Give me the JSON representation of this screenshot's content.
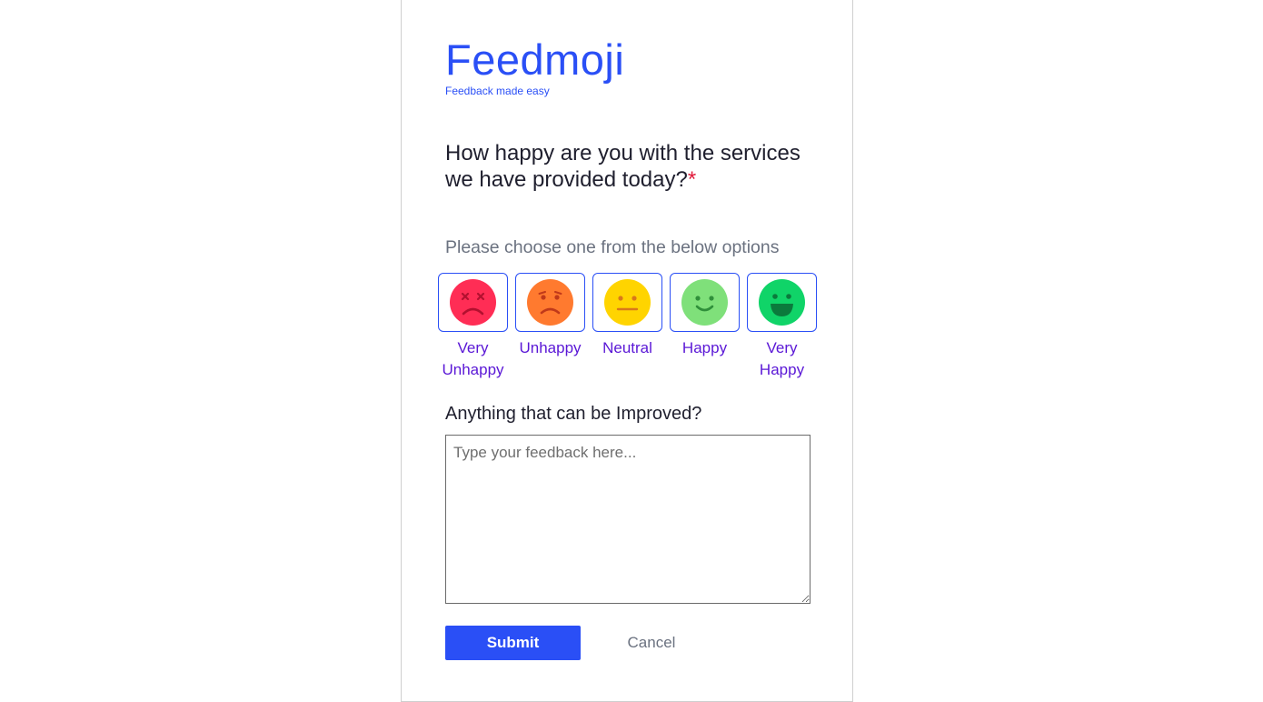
{
  "brand": {
    "title": "Feedmoji",
    "tagline": "Feedback made easy",
    "color": "#2a4ff6"
  },
  "question": {
    "text": "How happy are you with the services we have provided today?",
    "required_marker": "*"
  },
  "choose_hint": "Please choose one from the below options",
  "options": [
    {
      "label": "Very Unhappy",
      "icon": "very-unhappy-face-icon",
      "color": "#ff2d55"
    },
    {
      "label": "Unhappy",
      "icon": "unhappy-face-icon",
      "color": "#ff7a2f"
    },
    {
      "label": "Neutral",
      "icon": "neutral-face-icon",
      "color": "#ffd400"
    },
    {
      "label": "Happy",
      "icon": "happy-face-icon",
      "color": "#7fe07a"
    },
    {
      "label": "Very Happy",
      "icon": "very-happy-face-icon",
      "color": "#10d468"
    }
  ],
  "improve": {
    "label": "Anything that can be Improved?",
    "placeholder": "Type your feedback here...",
    "value": ""
  },
  "actions": {
    "submit_label": "Submit",
    "cancel_label": "Cancel"
  }
}
